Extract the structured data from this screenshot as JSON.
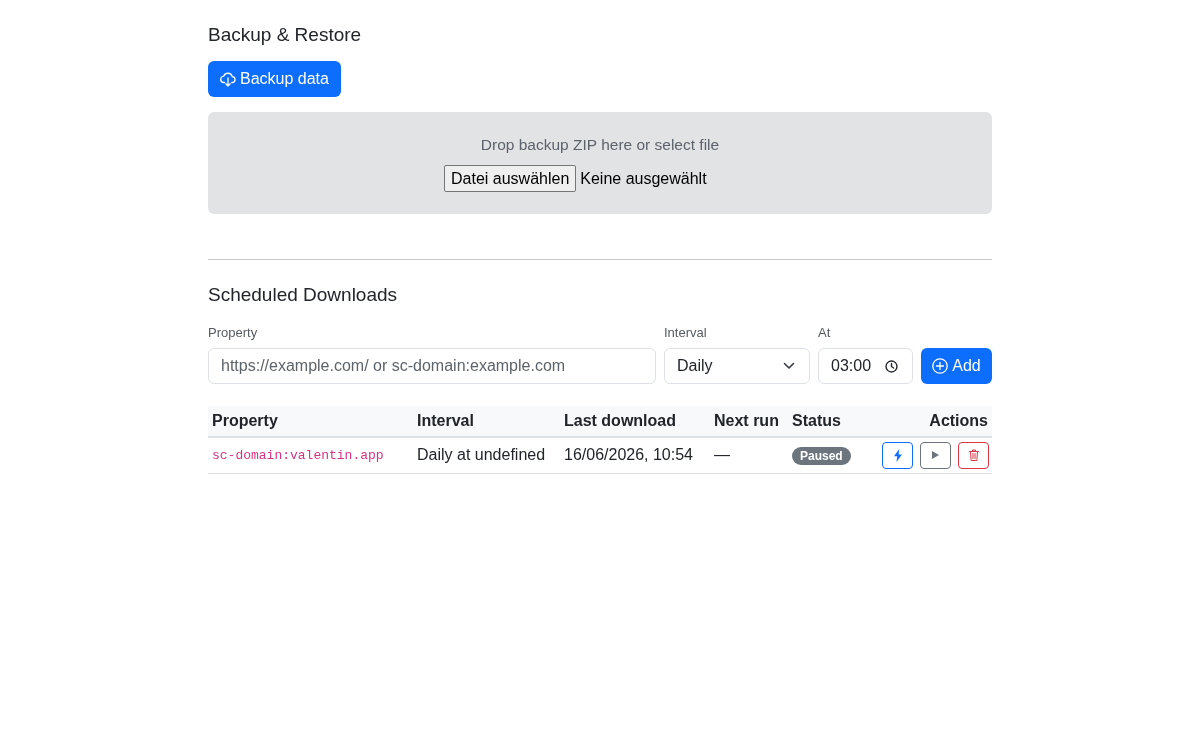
{
  "backup": {
    "title": "Backup & Restore",
    "button": "Backup data",
    "dropzone": {
      "text": "Drop backup ZIP here or select file",
      "file_button": "Datei auswählen",
      "file_status": "Keine ausgewählt"
    }
  },
  "scheduled": {
    "title": "Scheduled Downloads",
    "form": {
      "fields": [
        {
          "kind": "text",
          "label": "Property",
          "placeholder": "https://example.com/ or sc-domain:example.com"
        },
        {
          "kind": "select",
          "label": "Interval",
          "value": "Daily"
        },
        {
          "kind": "time",
          "label": "At",
          "value": "03:00"
        }
      ],
      "button": "Add"
    },
    "table": {
      "columns": [
        "Property",
        "Interval",
        "Last download",
        "Next run",
        "Status",
        "Actions"
      ],
      "rows": [
        {
          "property": "sc-domain:valentin.app",
          "interval": "Daily at undefined",
          "last_download": "16/06/2026, 10:54",
          "next_run": "—",
          "status": "Paused",
          "paused": true
        }
      ]
    }
  }
}
